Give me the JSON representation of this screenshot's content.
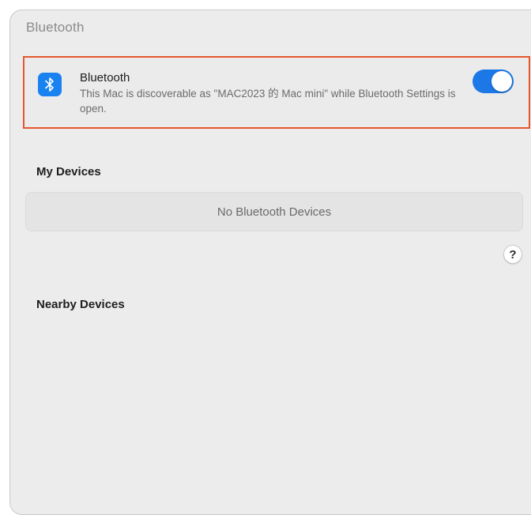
{
  "window": {
    "title": "Bluetooth"
  },
  "bluetooth": {
    "icon": "bluetooth-icon",
    "label": "Bluetooth",
    "description": "This Mac is discoverable as \"MAC2023 的 Mac mini\" while Bluetooth Settings is open.",
    "enabled": true,
    "toggle_color": "#1b78e6",
    "highlight_color": "#e4572e"
  },
  "my_devices": {
    "header": "My Devices",
    "empty_text": "No Bluetooth Devices"
  },
  "help": {
    "label": "?"
  },
  "nearby_devices": {
    "header": "Nearby Devices"
  }
}
